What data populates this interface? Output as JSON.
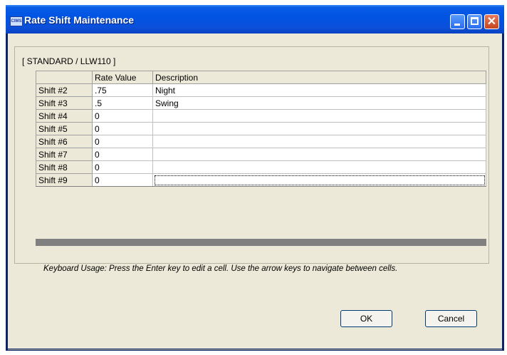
{
  "window": {
    "title": "Rate Shift Maintenance",
    "icon_text": "CIMS"
  },
  "group": {
    "title": "[ STANDARD / LLW110 ]"
  },
  "grid": {
    "headers": [
      "",
      "Rate Value",
      "Description"
    ],
    "rows": [
      {
        "shift": "Shift #2",
        "rate": ".75",
        "description": "Night"
      },
      {
        "shift": "Shift #3",
        "rate": ".5",
        "description": "Swing"
      },
      {
        "shift": "Shift #4",
        "rate": "0",
        "description": ""
      },
      {
        "shift": "Shift #5",
        "rate": "0",
        "description": ""
      },
      {
        "shift": "Shift #6",
        "rate": "0",
        "description": ""
      },
      {
        "shift": "Shift #7",
        "rate": "0",
        "description": ""
      },
      {
        "shift": "Shift #8",
        "rate": "0",
        "description": ""
      },
      {
        "shift": "Shift #9",
        "rate": "0",
        "description": ""
      }
    ]
  },
  "hint": "Keyboard Usage: Press the Enter key to edit a cell.  Use the arrow keys to navigate between cells.",
  "buttons": {
    "ok": "OK",
    "cancel": "Cancel"
  }
}
